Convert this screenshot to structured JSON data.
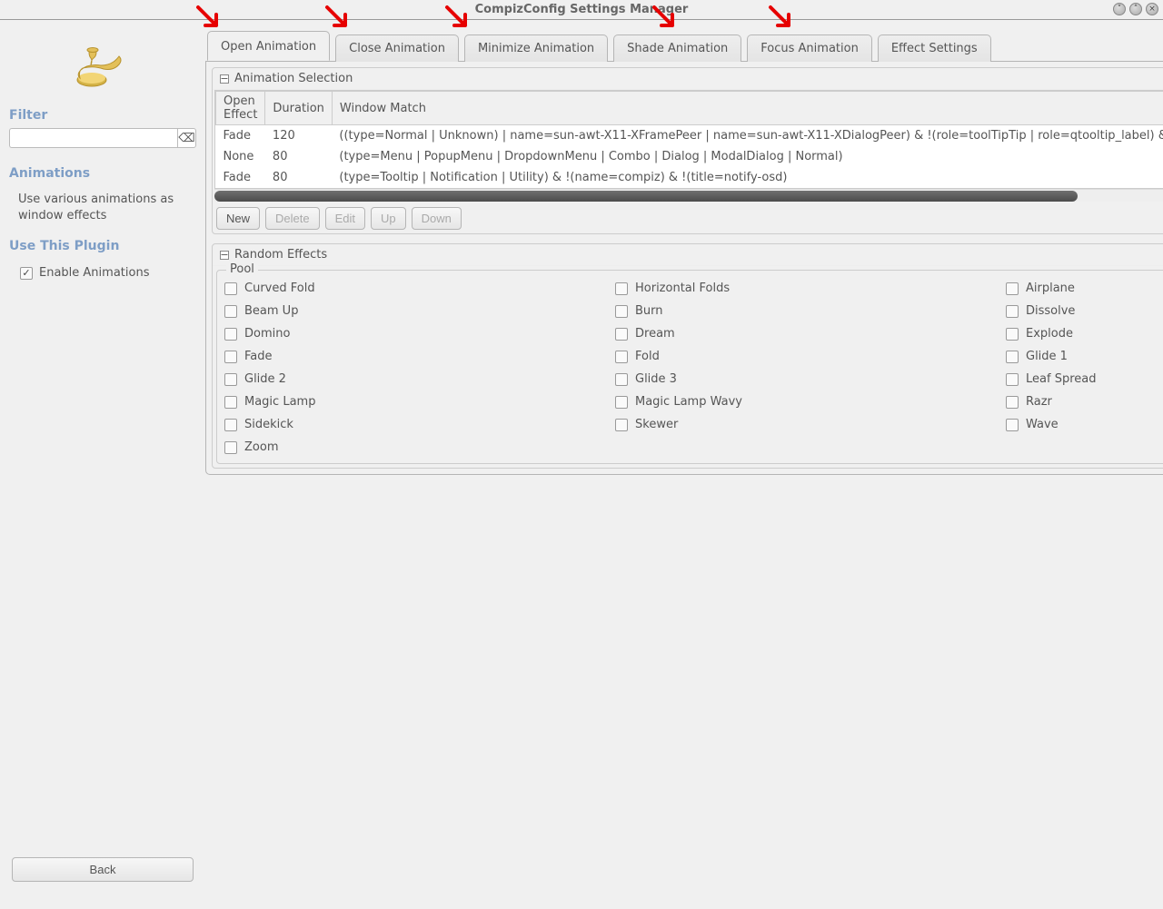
{
  "window": {
    "title": "CompizConfig Settings Manager"
  },
  "sidebar": {
    "filter_heading": "Filter",
    "filter_value": "",
    "filter_placeholder": "",
    "plugin_name": "Animations",
    "description": "Use various animations as window effects",
    "use_plugin_heading": "Use This Plugin",
    "enable_label": "Enable Animations",
    "enable_checked": true,
    "back_label": "Back"
  },
  "tabs": [
    {
      "label": "Open Animation",
      "active": true
    },
    {
      "label": "Close Animation",
      "active": false
    },
    {
      "label": "Minimize Animation",
      "active": false
    },
    {
      "label": "Shade Animation",
      "active": false
    },
    {
      "label": "Focus Animation",
      "active": false
    },
    {
      "label": "Effect Settings",
      "active": false
    }
  ],
  "animation_selection": {
    "title": "Animation Selection",
    "columns": [
      "Open Effect",
      "Duration",
      "Window Match"
    ],
    "rows": [
      {
        "effect": "Fade",
        "duration": "120",
        "match": "((type=Normal | Unknown) | name=sun-awt-X11-XFramePeer | name=sun-awt-X11-XDialogPeer) & !(role=toolTipTip | role=qtooltip_label) & !(type=Norm"
      },
      {
        "effect": "None",
        "duration": "80",
        "match": "(type=Menu | PopupMenu | DropdownMenu | Combo | Dialog | ModalDialog | Normal)"
      },
      {
        "effect": "Fade",
        "duration": "80",
        "match": "(type=Tooltip | Notification | Utility) & !(name=compiz) & !(title=notify-osd)"
      }
    ],
    "buttons": {
      "new": "New",
      "delete": "Delete",
      "edit": "Edit",
      "up": "Up",
      "down": "Down"
    }
  },
  "random_effects": {
    "title": "Random Effects",
    "pool_label": "Pool",
    "items": [
      "Curved Fold",
      "Horizontal Folds",
      "Airplane",
      "Beam Up",
      "Burn",
      "Dissolve",
      "Domino",
      "Dream",
      "Explode",
      "Fade",
      "Fold",
      "Glide 1",
      "Glide 2",
      "Glide 3",
      "Leaf Spread",
      "Magic Lamp",
      "Magic Lamp Wavy",
      "Razr",
      "Sidekick",
      "Skewer",
      "Wave",
      "Zoom"
    ]
  },
  "icons": {
    "clear": "⌫",
    "reset": "⌫"
  }
}
